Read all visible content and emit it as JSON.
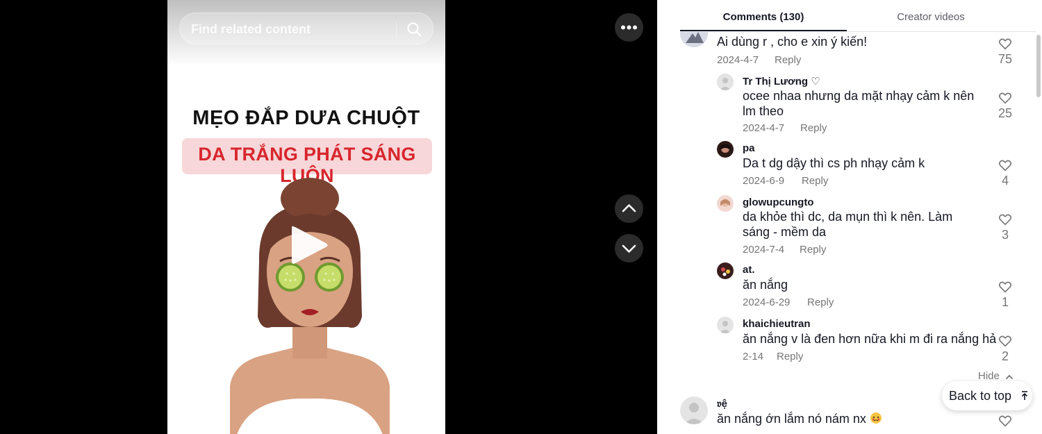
{
  "video": {
    "search_placeholder": "Find related content",
    "title_line1": "MẸO ĐẮP DƯA CHUỘT",
    "title_line2": "DA TRẮNG PHÁT SÁNG LUÔN",
    "accent_color": "#d8262d",
    "band_color": "#f7d7d9"
  },
  "tabs": {
    "comments_label": "Comments (130)",
    "creator_label": "Creator videos"
  },
  "comments": [
    {
      "text": "Ai dùng r , cho e xin ý kiến!",
      "date": "2024-4-7",
      "reply": "Reply",
      "likes": "75"
    },
    {
      "user": "Tr Thị Lương ♡",
      "text": "ocee nhaa nhưng da mặt nhạy cảm k nên lm theo",
      "date": "2024-4-7",
      "reply": "Reply",
      "likes": "25"
    },
    {
      "user": "pa",
      "text": "Da t dg dậy thì cs ph nhạy cảm k",
      "date": "2024-6-9",
      "reply": "Reply",
      "likes": "4"
    },
    {
      "user": "glowupcungto",
      "text": "da khỏe thì dc, da mụn thì k nên. Làm sáng - mềm da",
      "date": "2024-7-4",
      "reply": "Reply",
      "likes": "3"
    },
    {
      "user": "at.",
      "text": "ăn nắng",
      "date": "2024-6-29",
      "reply": "Reply",
      "likes": "1"
    },
    {
      "user": "khaichieutran",
      "text": "ăn nắng v là đen hơn nữa khi m đi ra nắng hả",
      "date": "2-14",
      "reply": "Reply",
      "likes": "2"
    },
    {
      "user": "𝔳ệ",
      "text": "ăn nắng ớn lắm nó nám nx"
    }
  ],
  "controls": {
    "hide_label": "Hide",
    "back_to_top_label": "Back to top"
  }
}
